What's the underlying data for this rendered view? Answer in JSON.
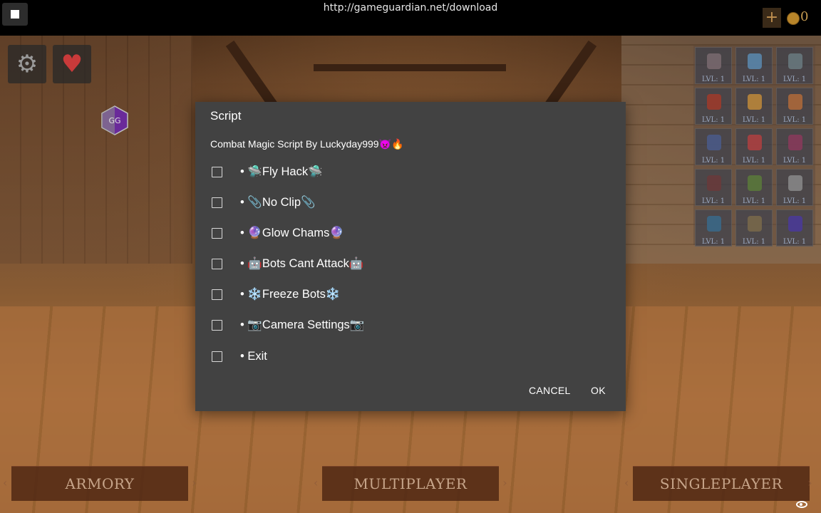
{
  "topbar": {
    "url": "http://gameguardian.net/download",
    "coins": "0"
  },
  "game": {
    "buttons": {
      "armory": "ARMORY",
      "multiplayer": "MULTIPLAYER",
      "singleplayer": "SINGLEPLAYER"
    },
    "level_label": "LVL: 1"
  },
  "dialog": {
    "title": "Script",
    "subtitle": "Combat Magic Script By Luckyday999👿🔥",
    "options": [
      {
        "label": "• 🛸Fly Hack🛸",
        "checked": false
      },
      {
        "label": "• 📎No Clip📎",
        "checked": false
      },
      {
        "label": "• 🔮Glow Chams🔮",
        "checked": false
      },
      {
        "label": "• 🤖Bots Cant Attack🤖",
        "checked": false
      },
      {
        "label": "• ❄️Freeze Bots❄️",
        "checked": false
      },
      {
        "label": "• 📷Camera Settings📷",
        "checked": false
      },
      {
        "label": "• Exit",
        "checked": false
      }
    ],
    "cancel": "CANCEL",
    "ok": "OK"
  },
  "colors": {
    "dialog_bg": "#424242",
    "topbar_bg": "#000000",
    "button_text": "#c7a58a",
    "heart": "#c93a3a"
  },
  "icons": [
    "stop-icon",
    "plus-icon",
    "coin-icon",
    "gear-icon",
    "heart-icon",
    "gameguardian-icon",
    "eye-icon"
  ]
}
